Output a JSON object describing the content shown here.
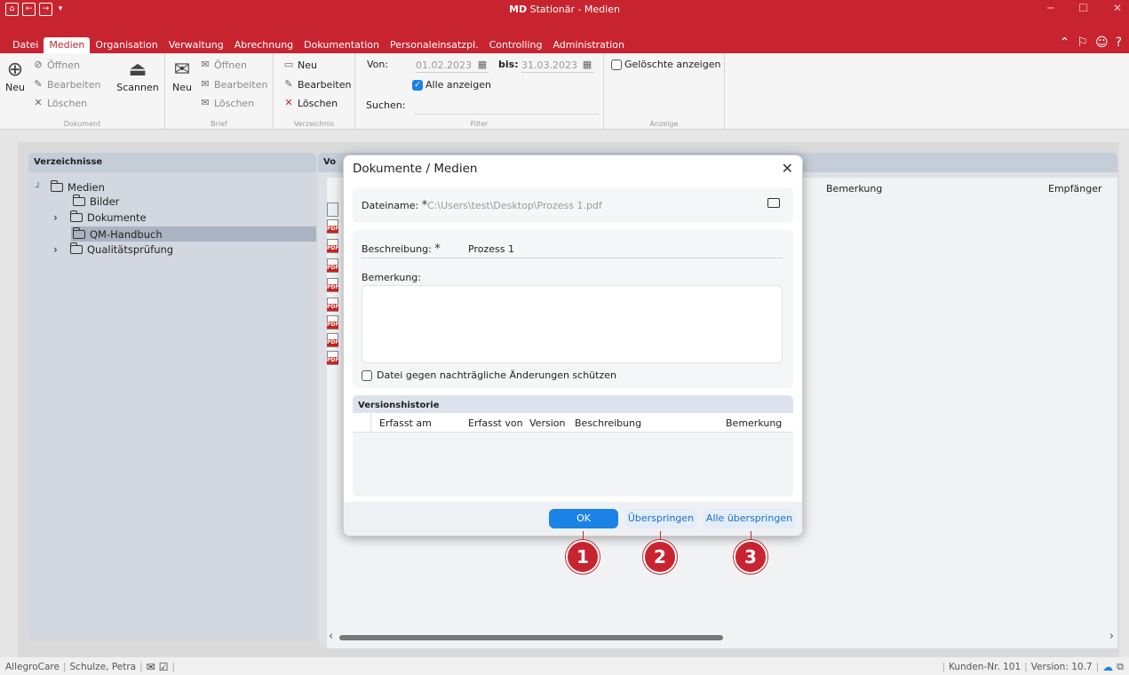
{
  "titlebar": {
    "brand": "MD",
    "title": " Stationär - Medien"
  },
  "menu": {
    "items": [
      "Datei",
      "Medien",
      "Organisation",
      "Verwaltung",
      "Abrechnung",
      "Dokumentation",
      "Personaleinsatzpl.",
      "Controlling",
      "Administration"
    ],
    "active": "Medien"
  },
  "ribbon": {
    "dokument": {
      "new": "Neu",
      "open": "Öffnen",
      "edit": "Bearbeiten",
      "delete": "Löschen",
      "scan": "Scannen",
      "group": "Dokument"
    },
    "brief": {
      "new": "Neu",
      "open": "Öffnen",
      "edit": "Bearbeiten",
      "delete": "Löschen",
      "group": "Brief"
    },
    "verzeichnis": {
      "new": "Neu",
      "edit": "Bearbeiten",
      "delete": "Löschen",
      "group": "Verzeichnis"
    },
    "filter": {
      "from_label": "Von:",
      "from_value": "01.02.2023",
      "to_label": "bis:",
      "to_value": "31.03.2023",
      "show_all": "Alle anzeigen",
      "search_label": "Suchen:",
      "group": "Filter"
    },
    "anzeige": {
      "deleted": "Gelöschte anzeigen",
      "group": "Anzeige"
    }
  },
  "left_panel": {
    "header": "Verzeichnisse",
    "tree": [
      {
        "label": "Medien"
      },
      {
        "label": "Bilder"
      },
      {
        "label": "Dokumente"
      },
      {
        "label": "QM-Handbuch"
      },
      {
        "label": "Qualitätsprüfung"
      }
    ]
  },
  "right_panel": {
    "header": "Vo",
    "columns": {
      "bemerkung": "Bemerkung",
      "empfaenger": "Empfänger"
    },
    "file_icon_label": "PDF"
  },
  "dialog": {
    "title": "Dokumente / Medien",
    "filename_label": "Dateiname:",
    "filename_value": "C:\\Users\\test\\Desktop\\Prozess 1.pdf",
    "required_mark": "*",
    "description_label": "Beschreibung:",
    "description_value": "Prozess 1",
    "remark_label": "Bemerkung:",
    "protect_label": "Datei gegen nachträgliche Änderungen schützen",
    "history": {
      "title": "Versionshistorie",
      "columns": [
        "Erfasst am",
        "Erfasst von",
        "Version",
        "Beschreibung",
        "Bemerkung"
      ]
    },
    "buttons": {
      "ok": "OK",
      "skip": "Überspringen",
      "skip_all": "Alle überspringen"
    }
  },
  "markers": [
    "1",
    "2",
    "3"
  ],
  "statusbar": {
    "company": "AllegroCare",
    "user": "Schulze, Petra",
    "customer": "Kunden-Nr. 101",
    "version": "Version: 10.7"
  }
}
